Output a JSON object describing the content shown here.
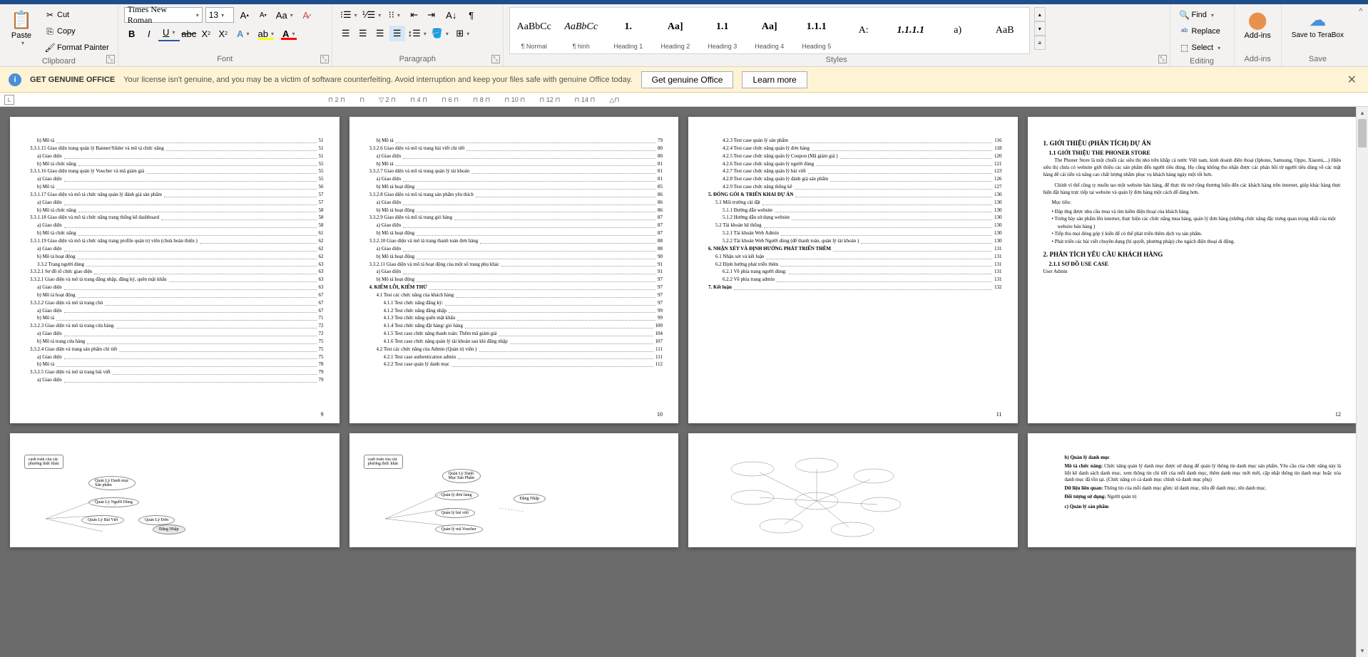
{
  "ribbon": {
    "clipboard": {
      "label": "Clipboard",
      "paste": "Paste",
      "cut": "Cut",
      "copy": "Copy",
      "format_painter": "Format Painter"
    },
    "font": {
      "label": "Font",
      "family": "Times New Roman",
      "size": "13"
    },
    "paragraph": {
      "label": "Paragraph"
    },
    "styles": {
      "label": "Styles",
      "items": [
        {
          "preview": "AaBbCc",
          "name": "¶ Normal"
        },
        {
          "preview": "AaBbCc",
          "name": "¶ hinh",
          "italic": true
        },
        {
          "preview": "1.",
          "name": "Heading 1",
          "bold": true
        },
        {
          "preview": "Aa]",
          "name": "Heading 2",
          "bold": true
        },
        {
          "preview": "1.1",
          "name": "Heading 3",
          "bold": true
        },
        {
          "preview": "Aa]",
          "name": "Heading 4",
          "bold": true
        },
        {
          "preview": "1.1.1",
          "name": "Heading 5",
          "bold": true
        },
        {
          "preview": "A:",
          "name": ""
        },
        {
          "preview": "1.1.1.1",
          "name": "",
          "italic": true,
          "bold": true
        },
        {
          "preview": "a)",
          "name": ""
        },
        {
          "preview": "AaB",
          "name": ""
        }
      ]
    },
    "editing": {
      "label": "Editing",
      "find": "Find",
      "replace": "Replace",
      "select": "Select"
    },
    "addins": {
      "label": "Add-ins",
      "btn": "Add-ins"
    },
    "save": {
      "label": "Save",
      "btn": "Save to TeraBox"
    }
  },
  "warning": {
    "title": "GET GENUINE OFFICE",
    "text": "Your license isn't genuine, and you may be a victim of software counterfeiting. Avoid interruption and keep your files safe with genuine Office today.",
    "btn1": "Get genuine Office",
    "btn2": "Learn more"
  },
  "ruler": {
    "corner": "L",
    "marks": [
      "2",
      "",
      "2",
      "4",
      "6",
      "8",
      "10",
      "12",
      "14"
    ]
  },
  "pages": {
    "p9": {
      "num": "9",
      "toc": [
        {
          "t": "b) Mô tả",
          "p": "51",
          "i": 1
        },
        {
          "t": "3.3.1.15 Giao diện trang quản lý Banner/Slider và mô tả chức năng",
          "p": "51",
          "i": 0
        },
        {
          "t": "a) Giao diện",
          "p": "51",
          "i": 1
        },
        {
          "t": "b) Mô tả chức năng",
          "p": "55",
          "i": 1
        },
        {
          "t": "3.3.1.16 Giao diện trang quản lý Voucher và mã giảm giá",
          "p": "55",
          "i": 0
        },
        {
          "t": "a) Giao diện",
          "p": "55",
          "i": 1
        },
        {
          "t": "b) Mô tả",
          "p": "56",
          "i": 1
        },
        {
          "t": "3.3.1.17 Giao diện và mô tả chức năng quản lý đánh giá sản phẩm",
          "p": "57",
          "i": 0
        },
        {
          "t": "a) Giao diện",
          "p": "57",
          "i": 1
        },
        {
          "t": "b) Mô tả chức năng",
          "p": "58",
          "i": 1
        },
        {
          "t": "3.3.1.18 Giao diện và mô tả chức năng trang thống kê dashboard",
          "p": "58",
          "i": 0
        },
        {
          "t": "a) Giao diện",
          "p": "58",
          "i": 1
        },
        {
          "t": "b) Mô tả chức năng",
          "p": "61",
          "i": 1
        },
        {
          "t": "3.3.1.19 Giao diện và mô tả chức năng trang profile quản trị viên (chưa hoàn thiện )",
          "p": "62",
          "i": 0
        },
        {
          "t": "a) Giao diện",
          "p": "62",
          "i": 1
        },
        {
          "t": "b) Mô tả hoạt động",
          "p": "62",
          "i": 1
        },
        {
          "t": "3.3.2 Trang người dùng",
          "p": "63",
          "i": 1
        },
        {
          "t": "3.3.2.1 Sơ đồ tổ chức giao diện",
          "p": "63",
          "i": 0
        },
        {
          "t": "3.3.2.1 Giao diện và mô tả trang đăng nhập, đăng ký, quên mật khẩu",
          "p": "63",
          "i": 0
        },
        {
          "t": "a) Giao diện",
          "p": "63",
          "i": 1
        },
        {
          "t": "b) Mô tả hoạt động",
          "p": "67",
          "i": 1
        },
        {
          "t": "3.3.2.2 Giao diện và mô tả trang chủ",
          "p": "67",
          "i": 0
        },
        {
          "t": "a) Giao diện",
          "p": "67",
          "i": 1
        },
        {
          "t": "b) Mô tả",
          "p": "71",
          "i": 1
        },
        {
          "t": "3.3.2.3 Giao diện và mô tả trang cửa hàng",
          "p": "72",
          "i": 0
        },
        {
          "t": "a) Giao diện",
          "p": "72",
          "i": 1
        },
        {
          "t": "b) Mô tả trang cửa hàng",
          "p": "75",
          "i": 1
        },
        {
          "t": "3.3.2.4 Giao diện và trang sản phẩm chi tiết",
          "p": "75",
          "i": 0
        },
        {
          "t": "a) Giao diện",
          "p": "75",
          "i": 1
        },
        {
          "t": "b) Mô tả",
          "p": "78",
          "i": 1
        },
        {
          "t": "3.3.2.5 Giao diện và mô tả trang bài viết",
          "p": "79",
          "i": 0
        },
        {
          "t": "a) Giao diện",
          "p": "79",
          "i": 1
        }
      ]
    },
    "p10": {
      "num": "10",
      "toc": [
        {
          "t": "b) Mô tả",
          "p": "79",
          "i": 1
        },
        {
          "t": "3.3.2.6 Giao diện và mô tả trang bài viết chi tiết",
          "p": "80",
          "i": 0
        },
        {
          "t": "a) Giao diện",
          "p": "80",
          "i": 1
        },
        {
          "t": "b) Mô tả",
          "p": "81",
          "i": 1
        },
        {
          "t": "3.3.2.7 Giao diện và mô tả trang quản lý tài khoản",
          "p": "81",
          "i": 0
        },
        {
          "t": "a) Giao diện",
          "p": "81",
          "i": 1
        },
        {
          "t": "b) Mô tả hoạt động",
          "p": "85",
          "i": 1
        },
        {
          "t": "3.3.2.8 Giao diện và mô tả trang sản phẩm yêu thích",
          "p": "86",
          "i": 0
        },
        {
          "t": "a) Giao diện",
          "p": "86",
          "i": 1
        },
        {
          "t": "b) Mô tả hoạt động",
          "p": "86",
          "i": 1
        },
        {
          "t": "3.3.2.9 Giao diện và mô tả trang giỏ hàng",
          "p": "87",
          "i": 0
        },
        {
          "t": "a) Giao diện",
          "p": "87",
          "i": 1
        },
        {
          "t": "b) Mô tả hoạt động",
          "p": "87",
          "i": 1
        },
        {
          "t": "3.3.2.10 Giao diện và mô tả trang thanh toán đơn hàng",
          "p": "88",
          "i": 0
        },
        {
          "t": "a) Giao diện",
          "p": "88",
          "i": 1
        },
        {
          "t": "b) Mô tả hoạt động",
          "p": "90",
          "i": 1
        },
        {
          "t": "3.3.2.11 Giao diện và mô tả hoạt động của một số trang phụ khác",
          "p": "91",
          "i": 0
        },
        {
          "t": "a) Giao diện",
          "p": "91",
          "i": 1
        },
        {
          "t": "b) Mô tả hoạt động",
          "p": "97",
          "i": 1
        },
        {
          "t": "4. KIỂM LỖI, KIỂM THỬ",
          "p": "97",
          "i": 0,
          "b": true
        },
        {
          "t": "4.1 Test các chức năng của khách hàng",
          "p": "97",
          "i": 1
        },
        {
          "t": "4.1.1 Test chức năng đăng ký:",
          "p": "97",
          "i": 2
        },
        {
          "t": "4.1.2 Test chức năng đăng nhập",
          "p": "99",
          "i": 2
        },
        {
          "t": "4.1.3 Test chức năng quên mật khẩu",
          "p": "99",
          "i": 2
        },
        {
          "t": "4.1.4 Test chức năng đặt hàng/ giỏ hàng",
          "p": "100",
          "i": 2
        },
        {
          "t": "4.1.5 Test case chức năng thanh toán: Thêm mã giảm giá",
          "p": "104",
          "i": 2
        },
        {
          "t": "4.1.6 Test case chức năng quản lý tài khoản sau khi đăng nhập",
          "p": "107",
          "i": 2
        },
        {
          "t": "4.2 Test các chức năng của Admin (Quản trị viên )",
          "p": "111",
          "i": 1
        },
        {
          "t": "4.2.1 Test case authentication admin",
          "p": "111",
          "i": 2
        },
        {
          "t": "4.2.2 Test case quản lý danh mục",
          "p": "112",
          "i": 2
        }
      ]
    },
    "p11": {
      "num": "11",
      "toc": [
        {
          "t": "4.2.3 Test case quản lý sản phẩm",
          "p": "116",
          "i": 2
        },
        {
          "t": "4.2.4 Test case chức năng quản lý đơn hàng",
          "p": "118",
          "i": 2
        },
        {
          "t": "4.2.5 Test case chức năng quản lý Coupon (Mã giảm giá )",
          "p": "120",
          "i": 2
        },
        {
          "t": "4.2.6 Test case chức năng quản lý người dùng",
          "p": "121",
          "i": 2
        },
        {
          "t": "4.2.7 Test case chức năng quản lý bài viết",
          "p": "123",
          "i": 2
        },
        {
          "t": "4.2.8 Test case chức năng quản lý đánh giá sản phẩm",
          "p": "126",
          "i": 2
        },
        {
          "t": "4.2.9 Test case chức năng thống kê",
          "p": "127",
          "i": 2
        },
        {
          "t": "5. ĐÓNG GÓI & TRIỂN KHAI DỰ ÁN",
          "p": "130",
          "i": 0,
          "b": true
        },
        {
          "t": "5.1 Môi trường cài đặt",
          "p": "130",
          "i": 1
        },
        {
          "t": "5.1.1 Đường dẫn website",
          "p": "130",
          "i": 2
        },
        {
          "t": "5.1.2 Hướng dẫn sử dụng website",
          "p": "130",
          "i": 2
        },
        {
          "t": "5.2 Tài khoản hệ thống",
          "p": "130",
          "i": 1
        },
        {
          "t": "5.2.1 Tài khoản Web Admin",
          "p": "130",
          "i": 2
        },
        {
          "t": "5.2.2 Tài khoản Web Người dùng (để thanh toán, quản lý tài khoản )",
          "p": "130",
          "i": 2
        },
        {
          "t": "6. NHẬN XÉT VÀ ĐỊNH HƯỚNG PHÁT TRIỂN THÊM",
          "p": "131",
          "i": 0,
          "b": true
        },
        {
          "t": "6.1 Nhận xét và kết luận",
          "p": "131",
          "i": 1
        },
        {
          "t": "6.2 Định hướng phát triển thêm",
          "p": "131",
          "i": 1
        },
        {
          "t": "6.2.1 Về phía trang người dùng:",
          "p": "131",
          "i": 2
        },
        {
          "t": "6.2.2 Về phía trang admin",
          "p": "131",
          "i": 2
        },
        {
          "t": "7. Kết luận",
          "p": "132",
          "i": 0,
          "b": true
        }
      ]
    },
    "p12": {
      "num": "12",
      "h1": "1. GIỚI THIỆU (PHÂN TÍCH) DỰ ÁN",
      "h2": "1.1 GIỚI THIỆU THE PHONER STORE",
      "para1": "The Phoner Store là một chuỗi các siêu thị nhỏ trên khắp cả nước Việt nam, kinh doanh điện thoại (Iphone, Samsung, Oppo, Xiaomi,...) Hiện siêu thị chưa có website giới thiệu các sản phẩm đến người tiêu dùng. Họ cũng không thu nhận được các phản hồi từ người tiêu dùng về các mặt hàng để cải tiến và nâng cao chất lượng nhằm phục vụ khách hàng ngày một tốt hơn.",
      "para2": "Chính vì thế công ty muốn tạo một website bán hàng, để thực thi mở rộng thương hiệu đến các khách hàng trên internet, giúp khác hàng thực hiện đặt hàng trực tiếp tại website và quản lý đơn hàng một cách dễ dàng hơn.",
      "muctieu": "Mục tiêu:",
      "li1": "Đáp ứng được nhu cầu mua và tìm kiếm điện thoại của khách hàng.",
      "li2": "Trưng bày sản phẩm lên internet, thực hiện các chức năng mua hàng, quản lý đơn hàng (những chức năng đặc trưng quan trọng nhất của một website bán hàng )",
      "li3": "Tiếp thu mọi đóng góp ý kiến để có thể phát triển thêm dịch vụ sản phẩm.",
      "li4": "Phát triển các bài viết chuyên dụng (bí quyết, phương pháp) cho ngách điện thoại di động.",
      "h1b": "2. PHÂN TÍCH YÊU CẦU KHÁCH HÀNG",
      "h2b": "2.1.1 SƠ ĐỒ USE CASE",
      "useradmin": "User Admin"
    },
    "p16": {
      "h3": "b) Quản lý danh mục",
      "mota": "Mô tả chức năng:",
      "mota_text": " Chức năng quản lý danh mục được sử dụng để quản lý thông tin danh mục sản phẩm. Yêu cầu của chức năng này là liệt kê danh sách danh mục, xem thông tin chi tiết của mỗi danh mục, thêm danh mục mới mới, cập nhật thông tin danh mục hoặc xóa danh mục đã tồn tại. (Chức năng có cả danh mục chính và danh mục phụ)",
      "dulieulq": "Dữ liệu liên quan:",
      "dulieulq_text": " Thông tin của mỗi danh mục gồm: id danh mục, tiêu đề danh mục, tên danh mục.",
      "doituong": "Đối tượng sử dụng:",
      "doituong_text": " Người quản trị",
      "h3b": "c) Quản lý sản phẩm"
    }
  }
}
